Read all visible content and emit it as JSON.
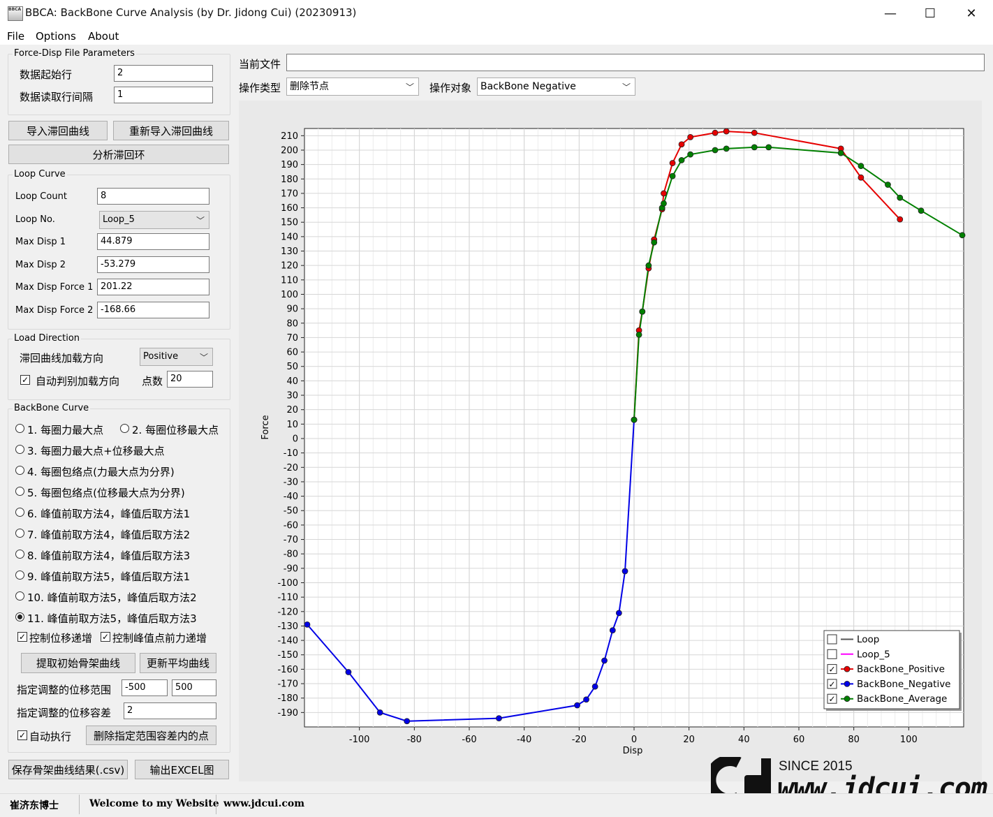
{
  "window": {
    "title": "BBCA: BackBone Curve Analysis (by Dr. Jidong Cui) (20230913)",
    "icon_text": "BBCA",
    "minimize": "—",
    "maximize": "☐",
    "close": "✕"
  },
  "menu": [
    "File",
    "Options",
    "About"
  ],
  "file_params": {
    "title": "Force-Disp File Parameters",
    "start_row_label": "数据起始行",
    "start_row_value": "2",
    "interval_label": "数据读取行间隔",
    "interval_value": "1"
  },
  "buttons": {
    "import": "导入滞回曲线",
    "reimport": "重新导入滞回曲线",
    "analyze": "分析滞回环",
    "extract": "提取初始骨架曲线",
    "update_avg": "更新平均曲线",
    "delete_points": "删除指定范围容差内的点",
    "save_csv": "保存骨架曲线结果(.csv)",
    "export_excel": "输出EXCEL图"
  },
  "loop_curve": {
    "title": "Loop Curve",
    "fields": [
      {
        "label": "Loop Count",
        "value": "8"
      },
      {
        "label": "Loop No.",
        "value": "Loop_5"
      },
      {
        "label": "Max Disp 1",
        "value": "44.879"
      },
      {
        "label": "Max Disp 2",
        "value": "-53.279"
      },
      {
        "label": "Max Disp Force 1",
        "value": "201.22"
      },
      {
        "label": "Max Disp Force 2",
        "value": "-168.66"
      }
    ]
  },
  "load_direction": {
    "title": "Load Direction",
    "direction_label": "滞回曲线加载方向",
    "direction_value": "Positive",
    "auto_label": "自动判别加载方向",
    "auto_checked": true,
    "points_label": "点数",
    "points_value": "20"
  },
  "backbone": {
    "title": "BackBone Curve",
    "options": [
      "1. 每圈力最大点",
      "2. 每圈位移最大点",
      "3. 每圈力最大点+位移最大点",
      "4. 每圈包络点(力最大点为分界)",
      "5. 每圈包络点(位移最大点为分界)",
      "6. 峰值前取方法4，峰值后取方法1",
      "7. 峰值前取方法4，峰值后取方法2",
      "8. 峰值前取方法4，峰值后取方法3",
      "9. 峰值前取方法5，峰值后取方法1",
      "10. 峰值前取方法5，峰值后取方法2",
      "11. 峰值前取方法5，峰值后取方法3"
    ],
    "selected_index": 10,
    "ctrl_disp_label": "控制位移递增",
    "ctrl_force_label": "控制峰值点前力递增",
    "range_label": "指定调整的位移范围",
    "range_min": "-500",
    "range_max": "500",
    "tol_label": "指定调整的位移容差",
    "tol_value": "2",
    "auto_exec_label": "自动执行"
  },
  "top_bar": {
    "current_file_label": "当前文件",
    "current_file_value": "",
    "op_type_label": "操作类型",
    "op_type_value": "删除节点",
    "op_target_label": "操作对象",
    "op_target_value": "BackBone Negative"
  },
  "status": {
    "name": "崔济东博士",
    "welcome": "Welcome to my Website",
    "site": "www.jdcui.com"
  },
  "watermark": {
    "since": "SINCE 2015",
    "url": "www.jdcui.com"
  },
  "chart_data": {
    "type": "line",
    "xlabel": "Disp",
    "ylabel": "Force",
    "xlim": [
      -120,
      120
    ],
    "ylim": [
      -200,
      215
    ],
    "x_ticks": [
      -100,
      -80,
      -60,
      -40,
      -20,
      0,
      20,
      40,
      60,
      80,
      100
    ],
    "y_ticks": [
      210,
      200,
      190,
      180,
      170,
      160,
      150,
      140,
      130,
      120,
      110,
      100,
      90,
      80,
      70,
      60,
      50,
      40,
      30,
      20,
      10,
      0,
      -10,
      -20,
      -30,
      -40,
      -50,
      -60,
      -70,
      -80,
      -90,
      -100,
      -110,
      -120,
      -130,
      -140,
      -150,
      -160,
      -170,
      -180,
      -190
    ],
    "grid": true,
    "legend_position": "bottom-right",
    "legend": [
      {
        "name": "Loop",
        "color": "#555555",
        "checked": false,
        "marker": false
      },
      {
        "name": "Loop_5",
        "color": "#ff00ff",
        "checked": false,
        "marker": false
      },
      {
        "name": "BackBone_Positive",
        "color": "#e60000",
        "checked": true,
        "marker": true
      },
      {
        "name": "BackBone_Negative",
        "color": "#0000e6",
        "checked": true,
        "marker": true
      },
      {
        "name": "BackBone_Average",
        "color": "#008000",
        "checked": true,
        "marker": true
      }
    ],
    "series": [
      {
        "name": "BackBone_Positive",
        "color": "#e60000",
        "points": [
          [
            0,
            13
          ],
          [
            1.8,
            75
          ],
          [
            3,
            88
          ],
          [
            5.3,
            118
          ],
          [
            7.3,
            138
          ],
          [
            10.2,
            159
          ],
          [
            10.8,
            170
          ],
          [
            14,
            191
          ],
          [
            17.3,
            204
          ],
          [
            20.5,
            209
          ],
          [
            29.5,
            212
          ],
          [
            33.6,
            213
          ],
          [
            43.8,
            212
          ],
          [
            75.3,
            201
          ],
          [
            82.6,
            181
          ],
          [
            96.8,
            152
          ]
        ]
      },
      {
        "name": "BackBone_Negative",
        "color": "#0000e6",
        "points": [
          [
            -119,
            -129
          ],
          [
            -104,
            -162
          ],
          [
            -92.5,
            -190
          ],
          [
            -82.7,
            -196
          ],
          [
            -49.2,
            -194
          ],
          [
            -20.7,
            -185
          ],
          [
            -17.4,
            -181
          ],
          [
            -14.2,
            -172
          ],
          [
            -10.8,
            -154
          ],
          [
            -7.8,
            -133
          ],
          [
            -5.5,
            -121
          ],
          [
            -3.3,
            -92
          ],
          [
            0,
            13
          ]
        ]
      },
      {
        "name": "BackBone_Average",
        "color": "#008000",
        "points": [
          [
            0,
            13
          ],
          [
            1.8,
            72
          ],
          [
            3,
            88
          ],
          [
            5.3,
            120
          ],
          [
            7.3,
            136
          ],
          [
            10.2,
            160
          ],
          [
            10.8,
            163
          ],
          [
            14,
            182
          ],
          [
            17.3,
            193
          ],
          [
            20.5,
            197
          ],
          [
            29.5,
            200
          ],
          [
            33.6,
            201
          ],
          [
            43.8,
            202
          ],
          [
            49,
            202
          ],
          [
            75.3,
            198
          ],
          [
            82.6,
            189
          ],
          [
            92.4,
            176
          ],
          [
            96.8,
            167
          ],
          [
            104.5,
            158
          ],
          [
            119.5,
            141
          ]
        ]
      }
    ]
  }
}
